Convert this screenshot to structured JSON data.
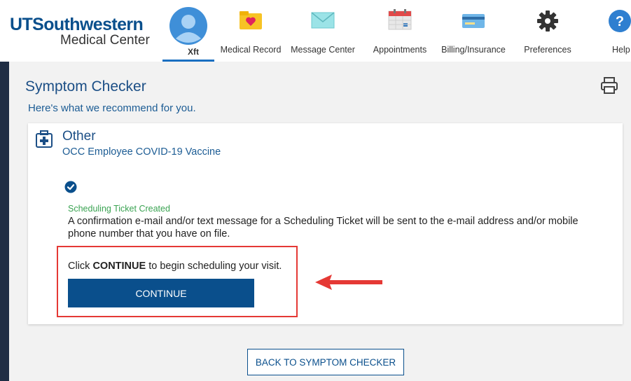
{
  "header": {
    "logo_line1": "UTSouthwestern",
    "logo_line2": "Medical Center",
    "profile_name": "Xft",
    "nav": [
      {
        "label": "Medical Record",
        "icon": "heart-folder-icon"
      },
      {
        "label": "Message Center",
        "icon": "envelope-icon"
      },
      {
        "label": "Appointments",
        "icon": "calendar-icon"
      },
      {
        "label": "Billing/Insurance",
        "icon": "credit-card-icon"
      },
      {
        "label": "Preferences",
        "icon": "gear-icon"
      },
      {
        "label": "Help",
        "icon": "help-icon"
      }
    ]
  },
  "page": {
    "title": "Symptom Checker",
    "subtitle": "Here's what we recommend for you."
  },
  "card": {
    "category": "Other",
    "category_sub": "OCC Employee COVID-19 Vaccine",
    "ticket_title": "Scheduling Ticket Created",
    "ticket_message": "A confirmation e-mail and/or text message for a Scheduling Ticket will be sent to the e-mail address and/or mobile phone number that you have on file.",
    "click_prefix": "Click ",
    "click_bold": "CONTINUE",
    "click_suffix": " to begin scheduling your visit.",
    "continue_label": "CONTINUE"
  },
  "back_label": "BACK TO SYMPTOM CHECKER",
  "colors": {
    "brand_blue": "#0a4f8c",
    "ticket_green": "#3aa352",
    "annotation_red": "#e53935",
    "sidebar_dark": "#1f2d44"
  }
}
